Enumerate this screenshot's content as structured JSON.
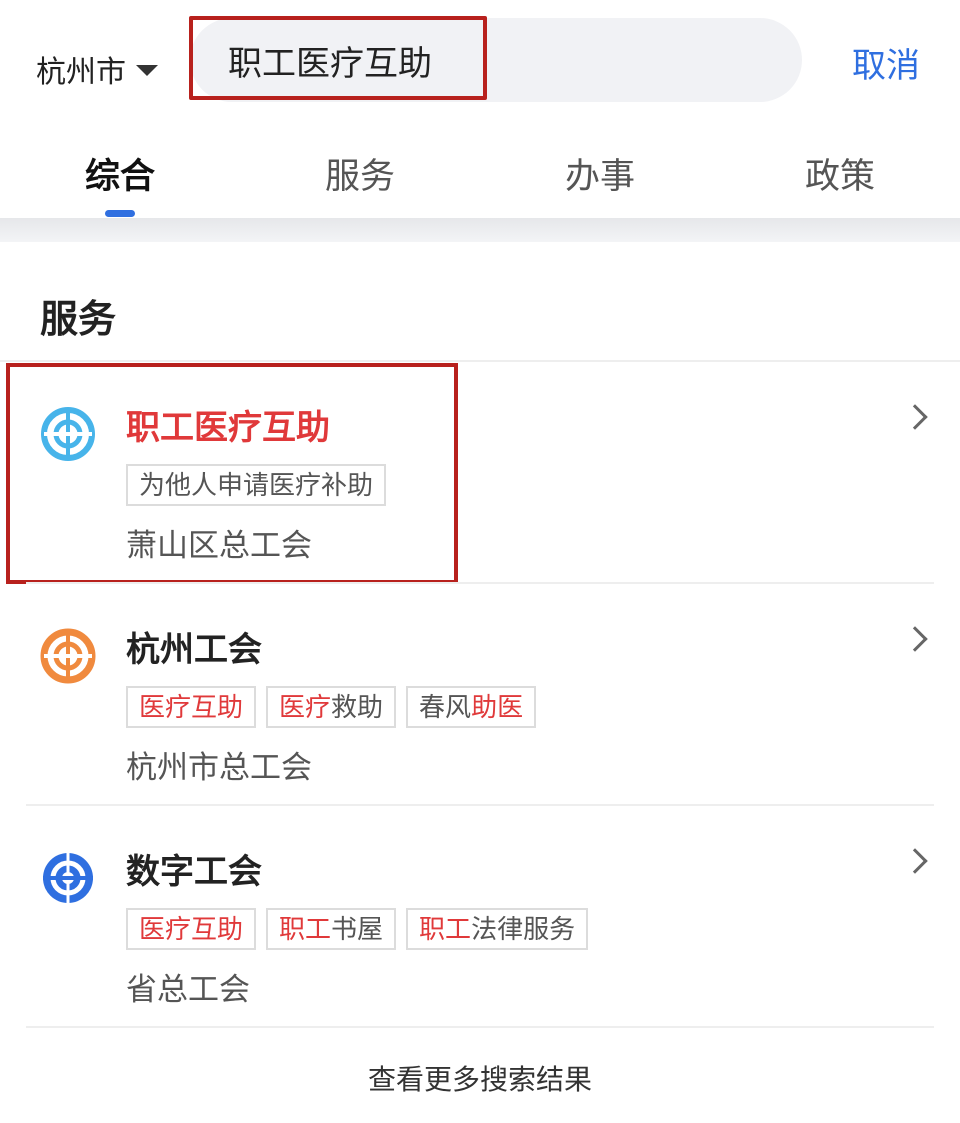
{
  "header": {
    "city": "杭州市",
    "search_value": "职工医疗互助",
    "cancel_label": "取消"
  },
  "tabs": [
    {
      "label": "综合",
      "active": true
    },
    {
      "label": "服务",
      "active": false
    },
    {
      "label": "办事",
      "active": false
    },
    {
      "label": "政策",
      "active": false
    }
  ],
  "section": {
    "title": "服务"
  },
  "results": [
    {
      "title": "职工医疗互助",
      "title_color": "#e0393a",
      "icon": "union-logo-lightblue-icon",
      "tags": [
        {
          "parts": [
            {
              "text": "为他人申请医疗补助",
              "hl": false
            }
          ]
        }
      ],
      "org": "萧山区总工会"
    },
    {
      "title": "杭州工会",
      "icon": "union-logo-orange-icon",
      "tags": [
        {
          "parts": [
            {
              "text": "医疗互助",
              "hl": true
            }
          ]
        },
        {
          "parts": [
            {
              "text": "医疗",
              "hl": true
            },
            {
              "text": "救助",
              "hl": false
            }
          ]
        },
        {
          "parts": [
            {
              "text": "春风",
              "hl": false
            },
            {
              "text": "助医",
              "hl": true
            }
          ]
        }
      ],
      "org": "杭州市总工会"
    },
    {
      "title": "数字工会",
      "icon": "union-logo-blue-icon",
      "tags": [
        {
          "parts": [
            {
              "text": "医疗互助",
              "hl": true
            }
          ]
        },
        {
          "parts": [
            {
              "text": "职工",
              "hl": true
            },
            {
              "text": "书屋",
              "hl": false
            }
          ]
        },
        {
          "parts": [
            {
              "text": "职工",
              "hl": true
            },
            {
              "text": "法律服务",
              "hl": false
            }
          ]
        }
      ],
      "org": "省总工会"
    }
  ],
  "more_label": "查看更多搜索结果",
  "colors": {
    "accent_blue": "#2f6fe0",
    "highlight_red": "#e0393a",
    "annotation_red": "#b8211d"
  }
}
